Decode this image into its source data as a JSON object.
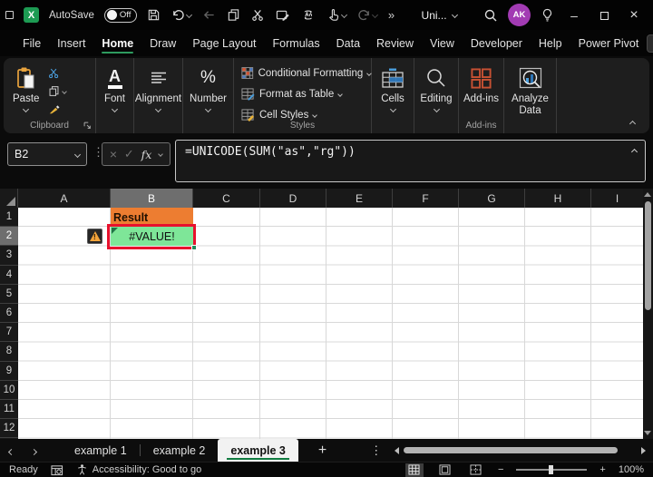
{
  "titlebar": {
    "autosave_label": "AutoSave",
    "autosave_state": "Off",
    "doc_title": "Uni...",
    "avatar_initials": "AK"
  },
  "icons": {
    "excel_x": "X",
    "overflow": "»",
    "minimize": "–",
    "close": "×",
    "more_vertical": "⋮",
    "add": "+",
    "percent": "%",
    "font_a": "A",
    "zoom_minus": "−",
    "zoom_plus": "+"
  },
  "menubar": {
    "items": [
      "File",
      "Insert",
      "Home",
      "Draw",
      "Page Layout",
      "Formulas",
      "Data",
      "Review",
      "View",
      "Developer",
      "Help",
      "Power Pivot"
    ],
    "active_item": "Home"
  },
  "ribbon": {
    "paste_label": "Paste",
    "clipboard_group_label": "Clipboard",
    "font_label": "Font",
    "alignment_label": "Alignment",
    "number_label": "Number",
    "conditional_formatting_label": "Conditional Formatting",
    "format_as_table_label": "Format as Table",
    "cell_styles_label": "Cell Styles",
    "styles_group_label": "Styles",
    "cells_label": "Cells",
    "editing_label": "Editing",
    "addins_label": "Add-ins",
    "addins_group_label": "Add-ins",
    "analyze_data_label": "Analyze Data"
  },
  "formula_bar": {
    "name_box_value": "B2",
    "fx_label": "fx",
    "formula": "=UNICODE(SUM(\"as\",\"rg\"))"
  },
  "grid": {
    "column_headers": [
      "A",
      "B",
      "C",
      "D",
      "E",
      "F",
      "G",
      "H",
      "I"
    ],
    "row_headers": [
      "1",
      "2",
      "3",
      "4",
      "5",
      "6",
      "7",
      "8",
      "9",
      "10",
      "11",
      "12"
    ],
    "selected_cell": "B2",
    "cells": {
      "B1": {
        "text": "Result",
        "bg": "#ED7D31"
      },
      "B2": {
        "text": "#VALUE!",
        "bg": "#7EE698"
      }
    }
  },
  "sheet_bar": {
    "tabs": [
      "example 1",
      "example 2",
      "example 3"
    ],
    "active_tab": "example 3"
  },
  "status_bar": {
    "mode": "Ready",
    "accessibility": "Accessibility: Good to go",
    "zoom_level": "100%"
  },
  "colors": {
    "accent_green": "#107C41",
    "logo_green": "#1d9b53",
    "share_button_green": "#21a366",
    "result_cell_orange": "#ED7D31",
    "value_cell_green": "#7EE698",
    "annotation_red": "#E8112D",
    "selection_header_gray": "#6e6e6e",
    "avatar_purple": "#A23BB3",
    "addins_icon_red": "#c75133",
    "scissors_blue": "#4a9edd"
  }
}
